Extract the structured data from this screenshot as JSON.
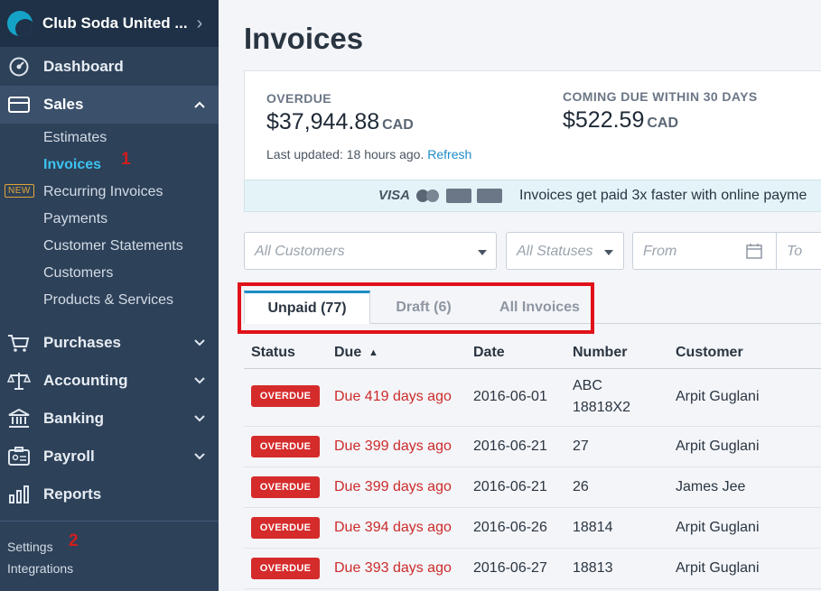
{
  "sidebar": {
    "business_name": "Club Soda United ...",
    "nav": [
      {
        "label": "Dashboard",
        "icon": "dashboard-icon"
      },
      {
        "label": "Sales",
        "icon": "sales-icon"
      },
      {
        "label": "Purchases",
        "icon": "cart-icon"
      },
      {
        "label": "Accounting",
        "icon": "scale-icon"
      },
      {
        "label": "Banking",
        "icon": "bank-icon"
      },
      {
        "label": "Payroll",
        "icon": "payroll-icon"
      },
      {
        "label": "Reports",
        "icon": "bar-chart-icon"
      }
    ],
    "sales_sub": [
      "Estimates",
      "Invoices",
      "Recurring Invoices",
      "Payments",
      "Customer Statements",
      "Customers",
      "Products & Services"
    ],
    "new_badge": "NEW",
    "footer": [
      "Settings",
      "Integrations"
    ],
    "markers": [
      "1",
      "2"
    ]
  },
  "page": {
    "title": "Invoices"
  },
  "summary": {
    "overdue_label": "OVERDUE",
    "overdue_amount": "$37,944.88",
    "overdue_currency": "CAD",
    "coming_label": "COMING DUE WITHIN 30 DAYS",
    "coming_amount": "$522.59",
    "coming_currency": "CAD",
    "updated_text": "Last updated: 18 hours ago.",
    "refresh_label": "Refresh"
  },
  "promo": {
    "text": "Invoices get paid 3x faster with online payme",
    "visa": "VISA"
  },
  "filters": {
    "customers_placeholder": "All Customers",
    "statuses_placeholder": "All Statuses",
    "from_placeholder": "From",
    "to_placeholder": "To"
  },
  "tabs": [
    "Unpaid (77)",
    "Draft (6)",
    "All Invoices"
  ],
  "table": {
    "headers": [
      "Status",
      "Due",
      "Date",
      "Number",
      "Customer"
    ],
    "rows": [
      {
        "status": "OVERDUE",
        "due": "Due 419 days ago",
        "date": "2016-06-01",
        "number": "ABC",
        "number2": "18818X2",
        "customer": "Arpit Guglani"
      },
      {
        "status": "OVERDUE",
        "due": "Due 399 days ago",
        "date": "2016-06-21",
        "number": "27",
        "customer": "Arpit Guglani"
      },
      {
        "status": "OVERDUE",
        "due": "Due 399 days ago",
        "date": "2016-06-21",
        "number": "26",
        "customer": "James Jee"
      },
      {
        "status": "OVERDUE",
        "due": "Due 394 days ago",
        "date": "2016-06-26",
        "number": "18814",
        "customer": "Arpit Guglani"
      },
      {
        "status": "OVERDUE",
        "due": "Due 393 days ago",
        "date": "2016-06-27",
        "number": "18813",
        "customer": "Arpit Guglani"
      }
    ]
  },
  "colors": {
    "sidebar": "#2d4159",
    "active_link": "#3cc3f0",
    "overdue": "#d52b2b",
    "accent": "#1d8cc6",
    "annotation": "#e0111a"
  }
}
